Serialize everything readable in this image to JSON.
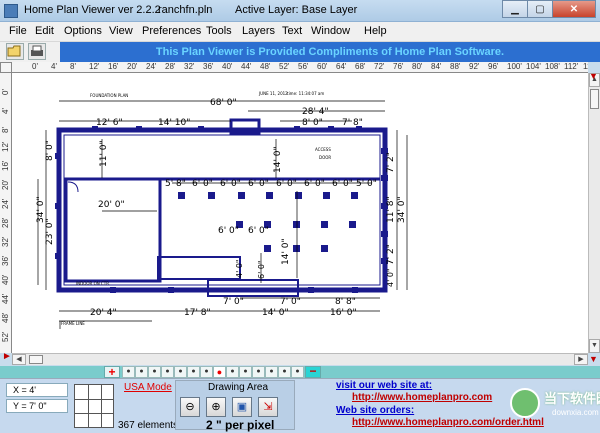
{
  "window": {
    "app_title": "Home Plan Viewer ver 2.2.2",
    "file_name": "ranchfn.pln",
    "active_layer": "Active Layer: Base Layer"
  },
  "menu": [
    "File",
    "Edit",
    "Options",
    "View",
    "Preferences",
    "Tools",
    "Layers",
    "Text",
    "Window",
    "Help"
  ],
  "toolbar": {
    "banner": "This Plan Viewer is Provided Compliments of Home Plan Software."
  },
  "ruler_top": [
    "0'",
    "4'",
    "8'",
    "12'",
    "16'",
    "20'",
    "24'",
    "28'",
    "32'",
    "36'",
    "40'",
    "44'",
    "48'",
    "52'",
    "56'",
    "60'",
    "64'",
    "68'",
    "72'",
    "76'",
    "80'",
    "84'",
    "88'",
    "92'",
    "96'",
    "100'",
    "104'",
    "108'",
    "112'",
    "116'",
    "12"
  ],
  "ruler_left": [
    "0'",
    "4'",
    "8'",
    "12'",
    "16'",
    "20'",
    "24'",
    "28'",
    "32'",
    "36'",
    "40'",
    "44'",
    "48'",
    "52'"
  ],
  "plan": {
    "label_foundation": "FOUNDATION PLAN",
    "label_date": "JUNE 11, 2012",
    "label_time": "time: 11:34:07 am",
    "label_access": "ACCESS",
    "label_door": "DOOR",
    "label_indoor": "INDOOR ON CTR.",
    "label_frame": "FRAME LINE",
    "dims": {
      "d68": "68' 0\"",
      "d28_4": "28' 4\"",
      "d12_6": "12' 6\"",
      "d14_10": "14' 10\"",
      "d8_0_top": "8' 0\"",
      "d7_8": "7' 8\"",
      "d8_0_left": "8' 0\"",
      "d11_0": "11' 0\"",
      "d34_0_left": "34' 0\"",
      "d23_0": "23' 0\"",
      "d20_0": "20' 0\"",
      "d14_0_mid": "14' 0\"",
      "d5_8": "5' 8\"",
      "d6_0": "6' 0\"",
      "d5_0": "5' 0\"",
      "d14_0_low": "14' 0\"",
      "d7_2_a": "7' 2\"",
      "d11_8": "11' 8\"",
      "d34_0_right": "34' 0\"",
      "d7_2_b": "7' 2\"",
      "d4_0": "4' 0\"",
      "d6_0_v": "6' 0\"",
      "d7_0_a": "7' 0\"",
      "d7_0_b": "7' 0\"",
      "d8_8": "8' 8\"",
      "d20_4": "20' 4\"",
      "d17_8": "17' 8\"",
      "d14_0_bot": "14' 0\"",
      "d16_0": "16' 0\"",
      "d4_0_r": "4' 0\"",
      "d6_0_r": "6' 0\""
    }
  },
  "layer_strip": {
    "add_label": "+",
    "remove_label": "−",
    "dot_label": "●"
  },
  "status": {
    "x_coord": "X = 4'",
    "y_coord": "Y = 7' 0\"",
    "usa_mode": "USA Mode",
    "elements": "367 elements",
    "drawing_area": "Drawing Area",
    "scale": "2 \" per pixel",
    "tools": {
      "zoom_out": "⊖",
      "zoom_in": "⊕",
      "zoom_fit": "▣",
      "zoom_window": "⇲"
    }
  },
  "web": {
    "visit_heading": "visit our web site at:",
    "home_url": "http://www.homeplanpro.com",
    "orders_heading": "Web site orders:",
    "order_url": "http://www.homeplanpro.com/order.html"
  },
  "watermark": {
    "title": "当下软件园",
    "url": "downxia.com"
  },
  "colors": {
    "banner_bg": "#2c6fd0",
    "banner_text": "#6ad4ff",
    "wall": "#1a1a8c",
    "dim_line": "#000000",
    "link_red": "#c00000",
    "link_blue": "#0000cc"
  }
}
